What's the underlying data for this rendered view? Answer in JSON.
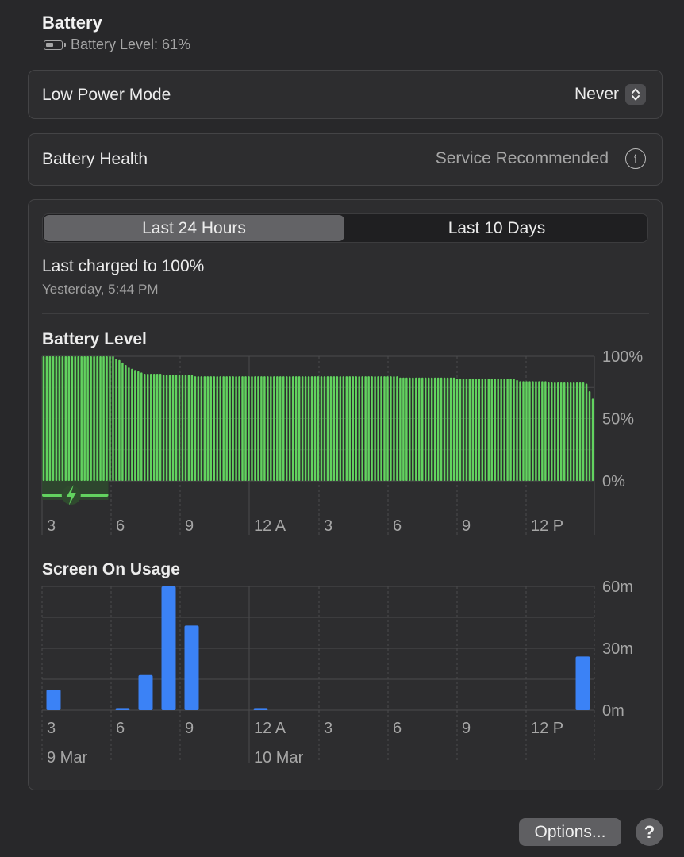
{
  "header": {
    "title": "Battery",
    "battery_level_text": "Battery Level: 61%"
  },
  "low_power": {
    "label": "Low Power Mode",
    "value": "Never"
  },
  "health": {
    "label": "Battery Health",
    "value": "Service Recommended"
  },
  "tabs": [
    {
      "label": "Last 24 Hours",
      "active": true
    },
    {
      "label": "Last 10 Days",
      "active": false
    }
  ],
  "last_charged": {
    "text": "Last charged to 100%",
    "time": "Yesterday, 5:44 PM"
  },
  "colors": {
    "battery_bar": "#62d35f",
    "usage_bar": "#3b82f6",
    "charging_segment": "#62d35f"
  },
  "battery_chart": {
    "title": "Battery Level",
    "chart_data": {
      "type": "bar",
      "title": "Battery Level",
      "y_tick_labels": [
        "100%",
        "50%",
        "0%"
      ],
      "ylim": [
        0,
        100
      ],
      "x_tick_labels": [
        "3",
        "6",
        "9",
        "12 A",
        "3",
        "6",
        "9",
        "12 P"
      ],
      "charging_icon": "charging-bolt-icon",
      "charging_fraction_of_range": 0.12,
      "values": [
        100,
        100,
        100,
        100,
        100,
        100,
        100,
        100,
        100,
        100,
        100,
        100,
        100,
        100,
        100,
        100,
        100,
        100,
        100,
        100,
        100,
        100,
        100,
        98,
        97,
        95,
        93,
        91,
        90,
        89,
        88,
        87,
        86,
        86,
        86,
        86,
        86,
        86,
        85,
        85,
        85,
        85,
        85,
        85,
        85,
        85,
        85,
        85,
        84,
        84,
        84,
        84,
        84,
        84,
        84,
        84,
        84,
        84,
        84,
        84,
        84,
        84,
        84,
        84,
        84,
        84,
        84,
        84,
        84,
        84,
        84,
        84,
        84,
        84,
        84,
        84,
        84,
        84,
        84,
        84,
        84,
        84,
        84,
        84,
        84,
        84,
        84,
        84,
        84,
        84,
        84,
        84,
        84,
        84,
        84,
        84,
        84,
        84,
        84,
        84,
        84,
        84,
        84,
        84,
        84,
        84,
        84,
        84,
        84,
        84,
        84,
        84,
        84,
        83,
        83,
        83,
        83,
        83,
        83,
        83,
        83,
        83,
        83,
        83,
        83,
        83,
        83,
        83,
        83,
        83,
        83,
        82,
        82,
        82,
        82,
        82,
        82,
        82,
        82,
        82,
        82,
        82,
        82,
        82,
        82,
        82,
        82,
        82,
        82,
        82,
        81,
        80,
        80,
        80,
        80,
        80,
        80,
        80,
        80,
        80,
        79,
        79,
        79,
        79,
        79,
        79,
        79,
        79,
        79,
        79,
        79,
        79,
        78,
        72,
        66
      ]
    }
  },
  "usage_chart": {
    "title": "Screen On Usage",
    "chart_data": {
      "type": "bar",
      "title": "Screen On Usage",
      "y_tick_labels": [
        "60m",
        "30m",
        "0m"
      ],
      "ylim": [
        0,
        60
      ],
      "x_tick_labels": [
        "3",
        "6",
        "9",
        "12 A",
        "3",
        "6",
        "9",
        "12 P"
      ],
      "date_labels": [
        "9 Mar",
        "10 Mar"
      ],
      "values": [
        10,
        0,
        0,
        1,
        17,
        60,
        41,
        0,
        0,
        1,
        0,
        0,
        0,
        0,
        0,
        0,
        0,
        0,
        0,
        0,
        0,
        0,
        0,
        26
      ]
    }
  },
  "footer": {
    "options_label": "Options...",
    "help_label": "?"
  }
}
